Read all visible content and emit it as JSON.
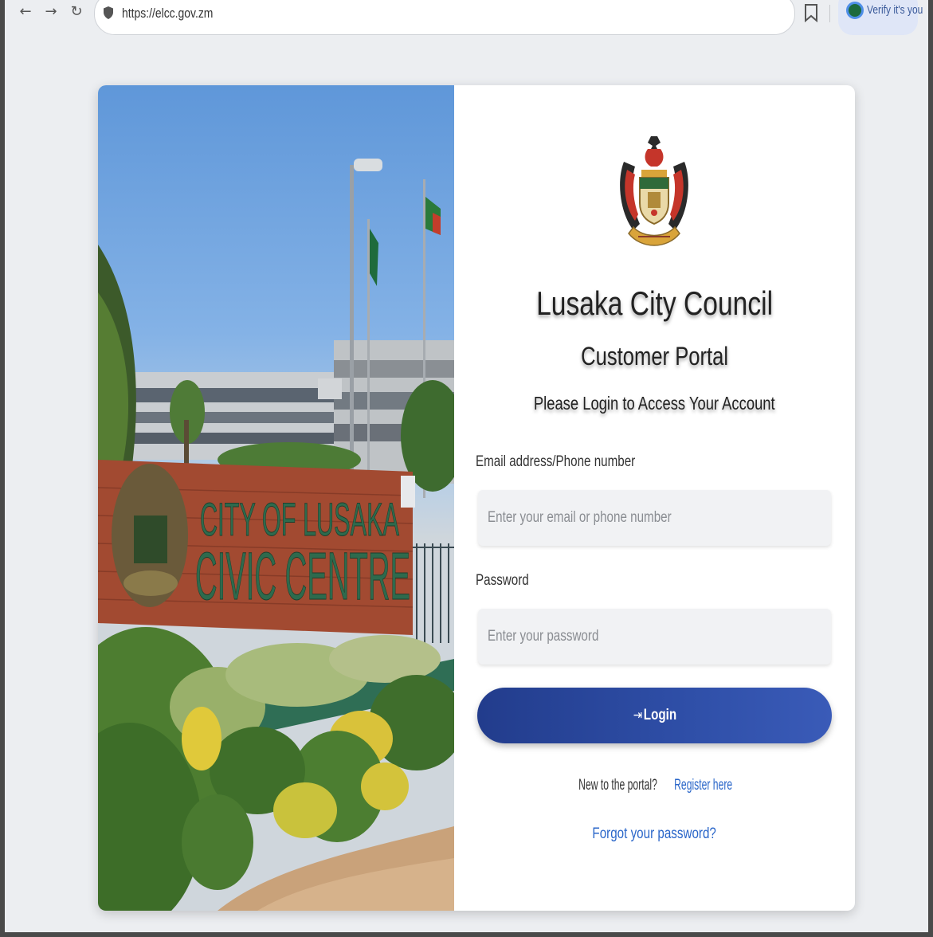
{
  "browser": {
    "back_icon": "←",
    "forward_icon": "→",
    "reload_icon": "↻",
    "url": "https://elcc.gov.zm",
    "profile_label": "Verify it's you"
  },
  "photo": {
    "sign_line1": "CITY OF LUSAKA",
    "sign_line2": "CIVIC CENTRE"
  },
  "login": {
    "org_name": "Lusaka City Council",
    "portal_name": "Customer Portal",
    "instruction": "Please Login to Access Your Account",
    "email_label": "Email address/Phone number",
    "email_placeholder": "Enter your email or phone number",
    "password_label": "Password",
    "password_placeholder": "Enter your password",
    "login_icon": "⇥",
    "login_label": "Login",
    "register_prompt": "New to the portal? ",
    "register_link": "Register here",
    "forgot_link": "Forgot your password?"
  },
  "colors": {
    "primary_button": "#2a4595",
    "link": "#2a66c9",
    "page_background": "#eceef1"
  }
}
